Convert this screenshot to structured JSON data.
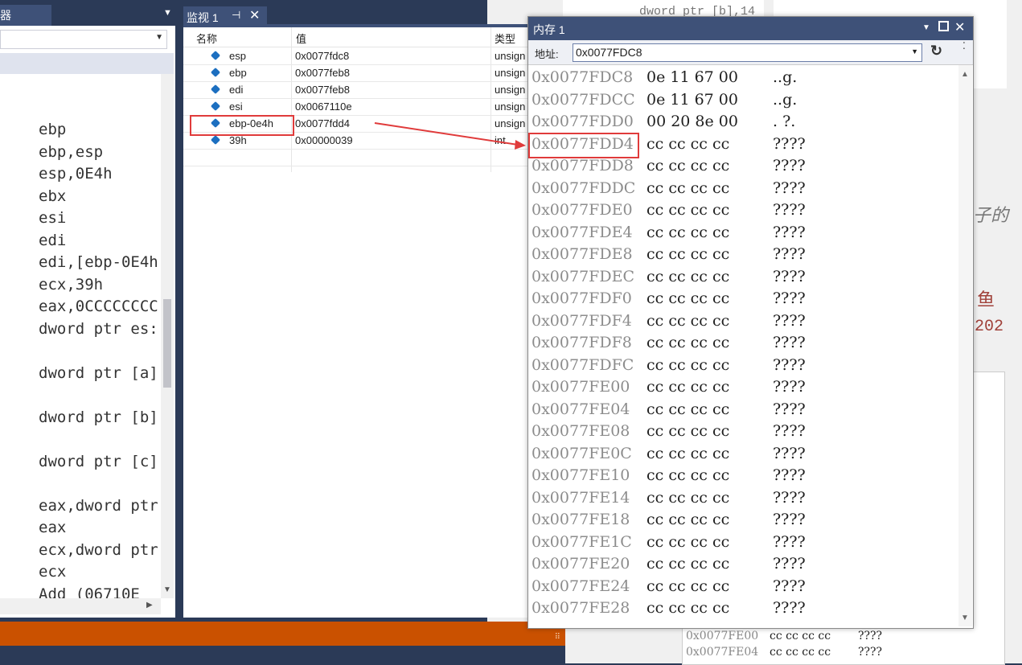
{
  "left_pane": {
    "tab_label": "器",
    "asm_lines": [
      "ebp",
      "ebp,esp",
      "esp,0E4h",
      "ebx",
      "esi",
      "edi",
      "edi,[ebp-0E4h",
      "ecx,39h",
      "eax,0CCCCCCCC",
      "dword ptr es:",
      "",
      "dword ptr [a]",
      "",
      "dword ptr [b]",
      "",
      "dword ptr [c]",
      "",
      "eax,dword ptr",
      "eax",
      "ecx,dword ptr",
      "ecx",
      "Add (06710E"
    ]
  },
  "watch": {
    "title": "监视 1",
    "pin_icon": "pin-icon",
    "close_icon": "close-icon",
    "columns": [
      "名称",
      "值",
      "类型"
    ],
    "rows": [
      {
        "name": "esp",
        "value": "0x0077fdc8",
        "type": "unsign"
      },
      {
        "name": "ebp",
        "value": "0x0077feb8",
        "type": "unsign"
      },
      {
        "name": "edi",
        "value": "0x0077feb8",
        "type": "unsign"
      },
      {
        "name": "esi",
        "value": "0x0067110e",
        "type": "unsign"
      },
      {
        "name": "ebp-0e4h",
        "value": "0x0077fdd4",
        "type": "unsign"
      },
      {
        "name": "39h",
        "value": "0x00000039",
        "type": "int"
      }
    ]
  },
  "memory": {
    "title": "内存 1",
    "address_label": "地址:",
    "address_value": "0x0077FDC8",
    "rows": [
      {
        "addr": "0x0077FDC8",
        "bytes": "0e 11 67 00",
        "chars": "..g."
      },
      {
        "addr": "0x0077FDCC",
        "bytes": "0e 11 67 00",
        "chars": "..g."
      },
      {
        "addr": "0x0077FDD0",
        "bytes": "00 20 8e 00",
        "chars": ". ?."
      },
      {
        "addr": "0x0077FDD4",
        "bytes": "cc cc cc cc",
        "chars": "????"
      },
      {
        "addr": "0x0077FDD8",
        "bytes": "cc cc cc cc",
        "chars": "????"
      },
      {
        "addr": "0x0077FDDC",
        "bytes": "cc cc cc cc",
        "chars": "????"
      },
      {
        "addr": "0x0077FDE0",
        "bytes": "cc cc cc cc",
        "chars": "????"
      },
      {
        "addr": "0x0077FDE4",
        "bytes": "cc cc cc cc",
        "chars": "????"
      },
      {
        "addr": "0x0077FDE8",
        "bytes": "cc cc cc cc",
        "chars": "????"
      },
      {
        "addr": "0x0077FDEC",
        "bytes": "cc cc cc cc",
        "chars": "????"
      },
      {
        "addr": "0x0077FDF0",
        "bytes": "cc cc cc cc",
        "chars": "????"
      },
      {
        "addr": "0x0077FDF4",
        "bytes": "cc cc cc cc",
        "chars": "????"
      },
      {
        "addr": "0x0077FDF8",
        "bytes": "cc cc cc cc",
        "chars": "????"
      },
      {
        "addr": "0x0077FDFC",
        "bytes": "cc cc cc cc",
        "chars": "????"
      },
      {
        "addr": "0x0077FE00",
        "bytes": "cc cc cc cc",
        "chars": "????"
      },
      {
        "addr": "0x0077FE04",
        "bytes": "cc cc cc cc",
        "chars": "????"
      },
      {
        "addr": "0x0077FE08",
        "bytes": "cc cc cc cc",
        "chars": "????"
      },
      {
        "addr": "0x0077FE0C",
        "bytes": "cc cc cc cc",
        "chars": "????"
      },
      {
        "addr": "0x0077FE10",
        "bytes": "cc cc cc cc",
        "chars": "????"
      },
      {
        "addr": "0x0077FE14",
        "bytes": "cc cc cc cc",
        "chars": "????"
      },
      {
        "addr": "0x0077FE18",
        "bytes": "cc cc cc cc",
        "chars": "????"
      },
      {
        "addr": "0x0077FE1C",
        "bytes": "cc cc cc cc",
        "chars": "????"
      },
      {
        "addr": "0x0077FE20",
        "bytes": "cc cc cc cc",
        "chars": "????"
      },
      {
        "addr": "0x0077FE24",
        "bytes": "cc cc cc cc",
        "chars": "????"
      },
      {
        "addr": "0x0077FE28",
        "bytes": "cc cc cc cc",
        "chars": "????"
      }
    ]
  },
  "background": {
    "code_snippet": "dword ptr [b],14",
    "doc_fragment_1": "子的",
    "doc_fragment_2": "鱼",
    "doc_fragment_3": "202",
    "mini_rows": [
      {
        "addr": "0x0077FE00",
        "bytes": "cc cc cc cc",
        "chars": "????"
      },
      {
        "addr": "0x0077FE04",
        "bytes": "cc cc cc cc",
        "chars": "????"
      }
    ]
  },
  "colors": {
    "chrome": "#2b3a57",
    "tab_active": "#3e5178",
    "status": "#ca5100",
    "highlight": "#e03b3b",
    "icon": "#1c6fc0"
  }
}
